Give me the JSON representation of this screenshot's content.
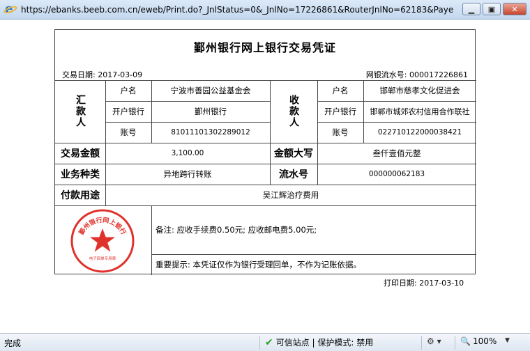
{
  "window": {
    "url": "https://ebanks.beeb.com.cn/eweb/Print.do?_JnlStatus=0&_JnlNo=17226861&RouterJnlNo=62183&PayerAc..."
  },
  "voucher": {
    "title": "鄞州银行网上银行交易凭证",
    "trade_date": "交易日期: 2017-03-09",
    "serial": "网银流水号: 000017226861",
    "payer": {
      "header": "汇款人",
      "name_label": "户名",
      "name": "宁波市善园公益基金会",
      "bank_label": "开户银行",
      "bank": "鄞州银行",
      "account_label": "账号",
      "account": "81011101302289012"
    },
    "payee": {
      "header": "收款人",
      "name_label": "户名",
      "name": "邯郸市慈孝文化促进会",
      "bank_label": "开户银行",
      "bank": "邯郸市城郊农村信用合作联社",
      "account_label": "账号",
      "account": "022710122000038421"
    },
    "amount_label": "交易金额",
    "amount": "3,100.00",
    "amount_upper_label": "金额大写",
    "amount_upper": "叁仟壹佰元整",
    "biz_type_label": "业务种类",
    "biz_type": "异地跨行转账",
    "flow_label": "流水号",
    "flow_no": "000000062183",
    "purpose_label": "付款用途",
    "purpose": "吴江辉治疗费用",
    "remark": "备注: 应收手续费0.50元; 应收邮电费5.00元;",
    "notice": "重要提示: 本凭证仅作为银行受理回单，不作为记账依据。",
    "stamp_text": "鄞州银行网上银行",
    "stamp_sub": "电子回单专用章",
    "stamp_color": "#e0322c",
    "print_date": "打印日期: 2017-03-10"
  },
  "statusbar": {
    "done": "完成",
    "trust": "可信站点 | 保护模式: 禁用",
    "zoom": "100%"
  }
}
